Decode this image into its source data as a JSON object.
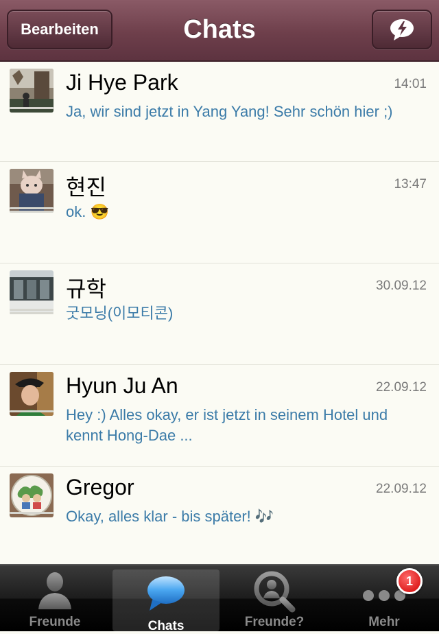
{
  "header": {
    "title": "Chats",
    "edit_label": "Bearbeiten"
  },
  "chats": [
    {
      "name": "Ji Hye Park",
      "time": "14:01",
      "message": "Ja, wir sind jetzt in Yang Yang! Sehr schön hier ;)"
    },
    {
      "name": "현진",
      "time": "13:47",
      "message": "ok. 😎"
    },
    {
      "name": "규학",
      "time": "30.09.12",
      "message": "굿모닝(이모티콘)"
    },
    {
      "name": "Hyun Ju An",
      "time": "22.09.12",
      "message": "Hey :) Alles okay, er ist jetzt in seinem Hotel und kennt Hong-Dae ..."
    },
    {
      "name": "Gregor",
      "time": "22.09.12",
      "message": "Okay, alles klar - bis später! 🎶"
    }
  ],
  "tabs": [
    {
      "label": "Freunde",
      "icon": "person-icon"
    },
    {
      "label": "Chats",
      "icon": "chat-bubble-icon"
    },
    {
      "label": "Freunde?",
      "icon": "search-person-icon"
    },
    {
      "label": "Mehr",
      "icon": "more-dots-icon",
      "badge": "1"
    }
  ],
  "colors": {
    "navbar": "#6e3f4b",
    "message_text": "#3b7ba8",
    "badge": "#d10000"
  }
}
